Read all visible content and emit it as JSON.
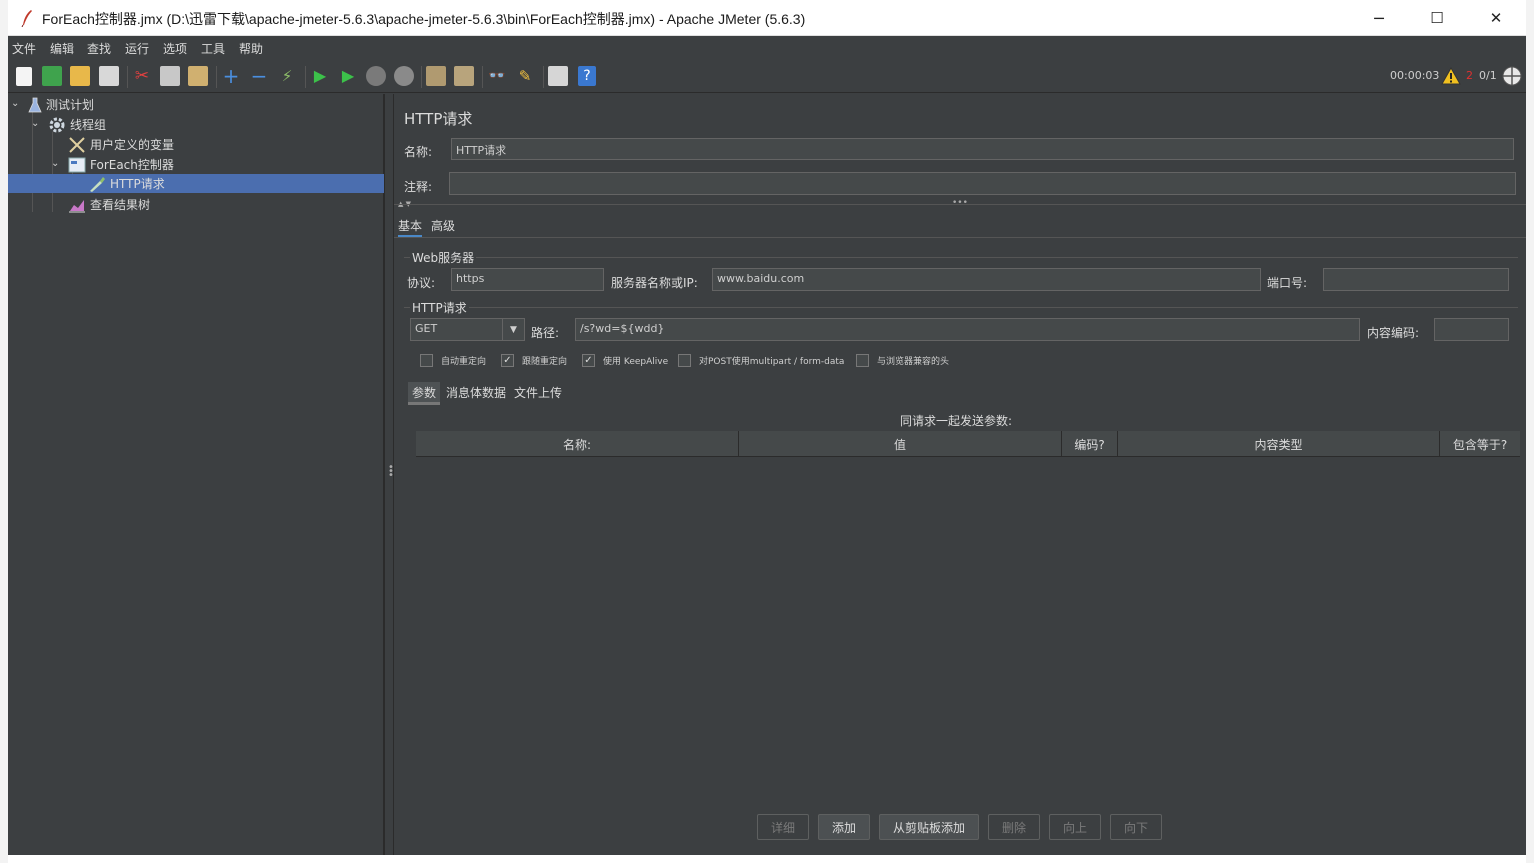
{
  "window": {
    "title": "ForEach控制器.jmx (D:\\迅雷下载\\apache-jmeter-5.6.3\\apache-jmeter-5.6.3\\bin\\ForEach控制器.jmx) - Apache JMeter (5.6.3)",
    "minimize": "─",
    "maximize": "☐",
    "close": "✕"
  },
  "menu": [
    "文件",
    "编辑",
    "查找",
    "运行",
    "选项",
    "工具",
    "帮助"
  ],
  "status": {
    "timer": "00:00:03",
    "warnings": "2",
    "threads": "0/1"
  },
  "tree": {
    "items": [
      {
        "label": "测试计划"
      },
      {
        "label": "线程组"
      },
      {
        "label": "用户定义的变量"
      },
      {
        "label": "ForEach控制器"
      },
      {
        "label": "HTTP请求"
      },
      {
        "label": "查看结果树"
      }
    ]
  },
  "panel": {
    "title": "HTTP请求",
    "name_label": "名称:",
    "name_value": "HTTP请求",
    "comment_label": "注释:",
    "comment_value": "",
    "tabs": [
      "基本",
      "高级"
    ],
    "web_server_legend": "Web服务器",
    "protocol_label": "协议:",
    "protocol_value": "https",
    "server_label": "服务器名称或IP:",
    "server_value": "www.baidu.com",
    "port_label": "端口号:",
    "port_value": "",
    "http_request_legend": "HTTP请求",
    "method_value": "GET",
    "path_label": "路径:",
    "path_value": "/s?wd=${wdd}",
    "encoding_label": "内容编码:",
    "encoding_value": "",
    "checkboxes": [
      {
        "label": "自动重定向",
        "checked": false
      },
      {
        "label": "跟随重定向",
        "checked": true
      },
      {
        "label": "使用 KeepAlive",
        "checked": true
      },
      {
        "label": "对POST使用multipart / form-data",
        "checked": false
      },
      {
        "label": "与浏览器兼容的头",
        "checked": false
      }
    ],
    "sub_tabs": [
      "参数",
      "消息体数据",
      "文件上传"
    ],
    "params_caption": "同请求一起发送参数:",
    "columns": [
      "名称:",
      "值",
      "编码?",
      "内容类型",
      "包含等于?"
    ],
    "buttons": {
      "detail": "详细",
      "add": "添加",
      "add_clipboard": "从剪贴板添加",
      "delete": "删除",
      "up": "向上",
      "down": "向下"
    }
  },
  "colors": {
    "background": "#3c3f41",
    "selection": "#4b6eaf",
    "text": "#dcdcdc"
  }
}
